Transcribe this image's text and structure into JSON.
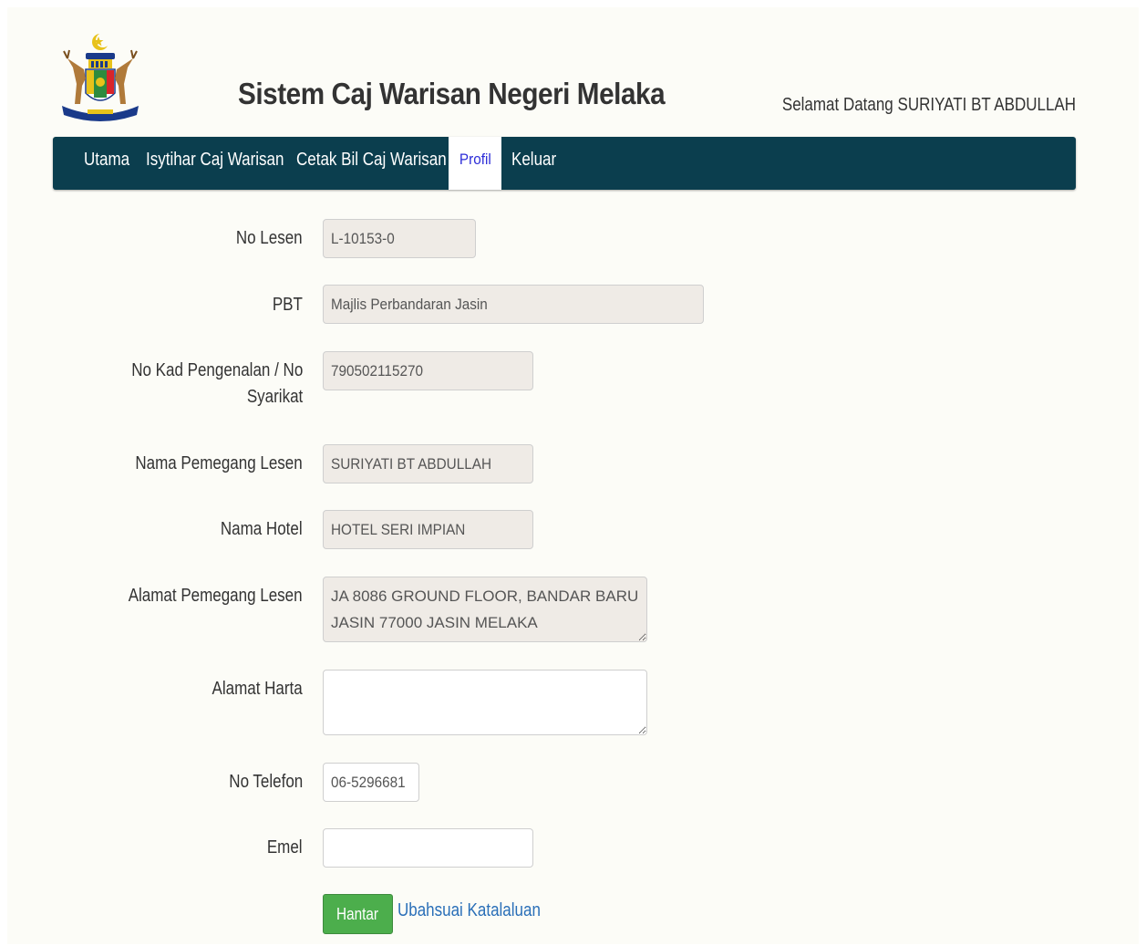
{
  "header": {
    "title": "Sistem Caj Warisan Negeri Melaka",
    "welcome": "Selamat Datang SURIYATI BT ABDULLAH"
  },
  "nav": {
    "items": [
      {
        "label": "Utama"
      },
      {
        "label": "Isytihar Caj Warisan"
      },
      {
        "label": "Cetak Bil Caj Warisan"
      },
      {
        "label": "Profil",
        "active": true
      },
      {
        "label": "Keluar"
      }
    ]
  },
  "form": {
    "no_lesen": {
      "label": "No Lesen",
      "value": "L-10153-0"
    },
    "pbt": {
      "label": "PBT",
      "value": "Majlis Perbandaran Jasin"
    },
    "no_kp": {
      "label_line1": "No Kad Pengenalan / No",
      "label_line2": "Syarikat",
      "value": "790502115270"
    },
    "nama_pemegang": {
      "label": "Nama Pemegang Lesen",
      "value": "SURIYATI BT ABDULLAH"
    },
    "nama_hotel": {
      "label": "Nama Hotel",
      "value": "HOTEL SERI IMPIAN"
    },
    "alamat_pemegang": {
      "label": "Alamat Pemegang Lesen",
      "value": "JA 8086 GROUND FLOOR, BANDAR BARU JASIN 77000 JASIN MELAKA"
    },
    "alamat_harta": {
      "label": "Alamat Harta",
      "value": ""
    },
    "no_telefon": {
      "label": "No Telefon",
      "value": "06-5296681"
    },
    "emel": {
      "label": "Emel",
      "value": ""
    }
  },
  "actions": {
    "submit": "Hantar",
    "change_password": "Ubahsuai Katalaluan"
  },
  "colors": {
    "navbar": "#0b3e4e",
    "submit": "#4cae4c",
    "link": "#2a6fb8",
    "active_tab_text": "#2d2dd8"
  }
}
